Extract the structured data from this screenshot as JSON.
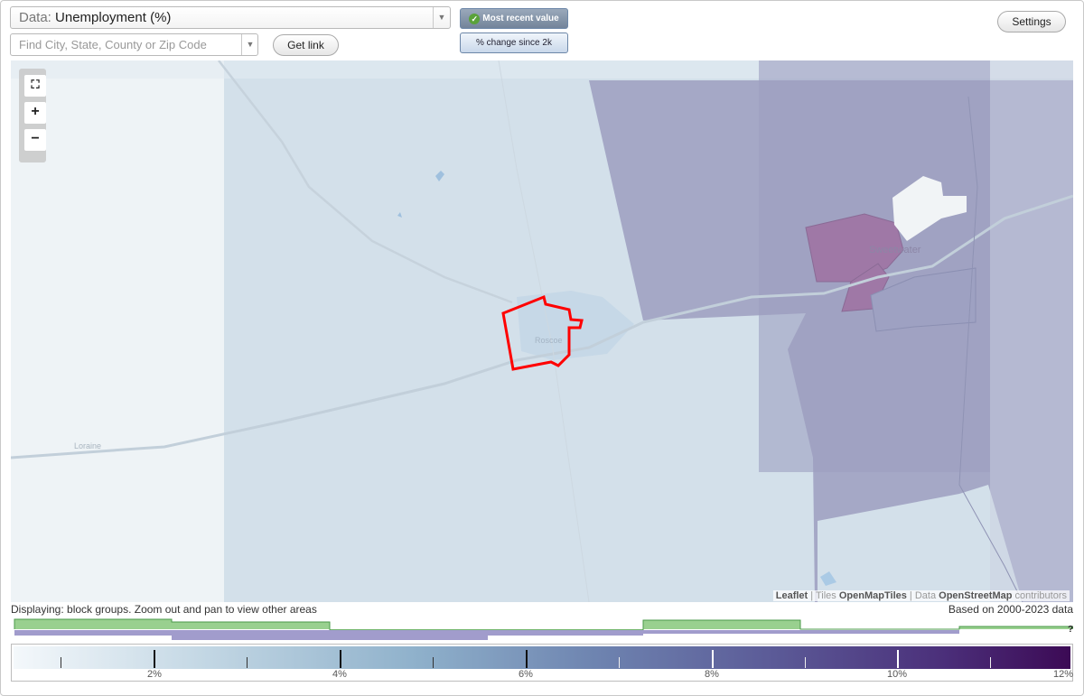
{
  "controls": {
    "data_label": "Data:",
    "data_value": "Unemployment (%)",
    "search_placeholder": "Find City, State, County or Zip Code",
    "get_link": "Get link",
    "most_recent": "Most recent value",
    "pct_change": "% change since 2k",
    "settings": "Settings"
  },
  "map": {
    "places": {
      "sweetwater": "Sweetwater",
      "roscoe": "Roscoe",
      "loraine": "Loraine"
    },
    "attribution": {
      "leaflet": "Leaflet",
      "tiles_prefix": "Tiles",
      "tiles": "OpenMapTiles",
      "data_prefix": "Data",
      "osm": "OpenStreetMap",
      "contributors": "contributors"
    },
    "highlight_color": "#ff0000"
  },
  "status": {
    "displaying": "Displaying: block groups. Zoom out and pan to view other areas",
    "based_on": "Based on 2000-2023 data"
  },
  "legend": {
    "labels": [
      "2%",
      "4%",
      "6%",
      "8%",
      "10%",
      "12%"
    ],
    "unknown": "?"
  }
}
